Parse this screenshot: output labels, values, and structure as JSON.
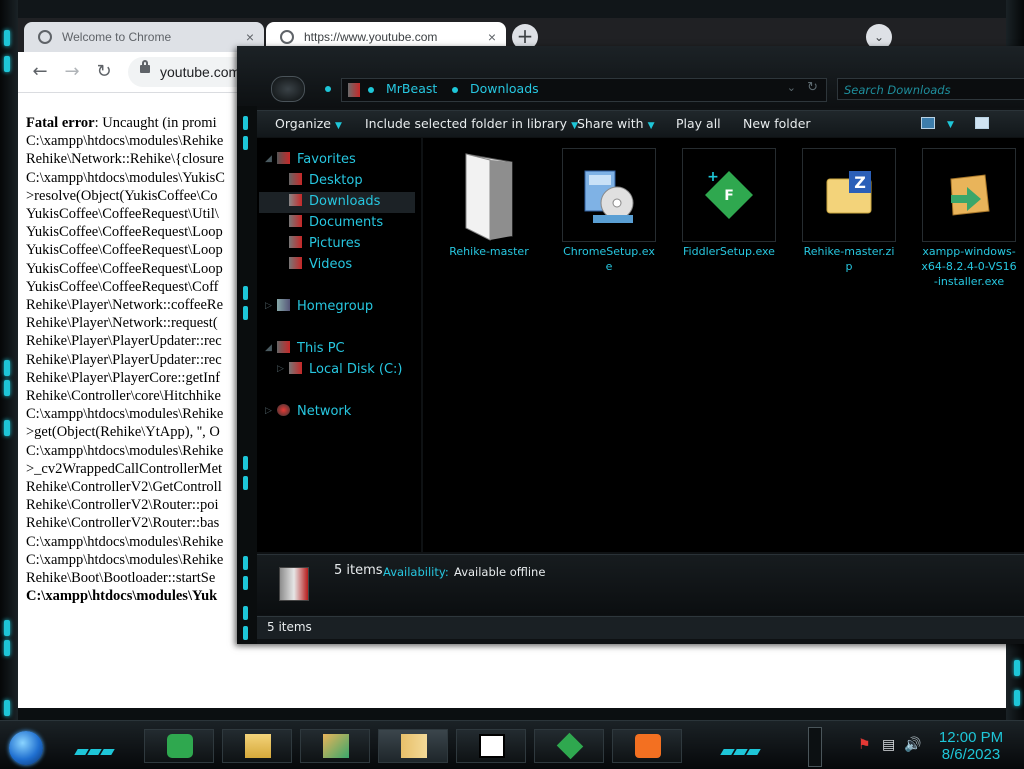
{
  "chrome": {
    "tab1_title": "Welcome to Chrome",
    "tab2_title": "https://www.youtube.com",
    "tab_close": "×",
    "new_tab": "+",
    "tab_menu": "⌄",
    "url": "youtube.com",
    "error_label": "Fatal error",
    "error_lines": [
      ": Uncaught (in promi",
      "C:\\xampp\\htdocs\\modules\\Rehike",
      "Rehike\\Network::Rehike\\{closure",
      "C:\\xampp\\htdocs\\modules\\YukisC",
      ">resolve(Object(YukisCoffee\\Co",
      "YukisCoffee\\CoffeeRequest\\Util\\",
      "YukisCoffee\\CoffeeRequest\\Loop",
      "YukisCoffee\\CoffeeRequest\\Loop",
      "YukisCoffee\\CoffeeRequest\\Loop",
      "YukisCoffee\\CoffeeRequest\\Coff",
      "Rehike\\Player\\Network::coffeeRe",
      "Rehike\\Player\\Network::request(",
      "Rehike\\Player\\PlayerUpdater::rec",
      "Rehike\\Player\\PlayerUpdater::rec",
      "Rehike\\Player\\PlayerCore::getInf",
      "Rehike\\Controller\\core\\Hitchhike",
      "C:\\xampp\\htdocs\\modules\\Rehike",
      ">get(Object(Rehike\\YtApp), '', O",
      "C:\\xampp\\htdocs\\modules\\Rehike",
      ">_cv2WrappedCallControllerMet",
      "Rehike\\ControllerV2\\GetControll",
      "Rehike\\ControllerV2\\Router::poi",
      "Rehike\\ControllerV2\\Router::bas",
      "C:\\xampp\\htdocs\\modules\\Rehike",
      "C:\\xampp\\htdocs\\modules\\Rehike",
      "Rehike\\Boot\\Bootloader::startSe",
      "C:\\xampp\\htdocs\\modules\\Yuk"
    ]
  },
  "explorer": {
    "breadcrumb": [
      "MrBeast",
      "Downloads"
    ],
    "search_placeholder": "Search Downloads",
    "commands": [
      "Organize",
      "Include selected folder in library",
      "Share with",
      "Play all",
      "New folder"
    ],
    "nav": {
      "favorites": "Favorites",
      "desktop": "Desktop",
      "downloads": "Downloads",
      "documents": "Documents",
      "pictures": "Pictures",
      "videos": "Videos",
      "homegroup": "Homegroup",
      "this_pc": "This PC",
      "local_disk": "Local Disk (C:)",
      "network": "Network"
    },
    "files": [
      {
        "name": "Rehike-master",
        "icon": "folder-icon"
      },
      {
        "name": "ChromeSetup.exe",
        "icon": "installer-icon"
      },
      {
        "name": "FiddlerSetup.exe",
        "icon": "fiddler-icon"
      },
      {
        "name": "Rehike-master.zip",
        "icon": "zip-icon"
      },
      {
        "name": "xampp-windows-x64-8.2.4-0-VS16-installer.exe",
        "icon": "xampp-installer-icon"
      }
    ],
    "details": {
      "count": "5 items",
      "availability_label": "Availability:",
      "availability_value": "Available offline"
    },
    "status": "5 items"
  },
  "taskbar": {
    "time": "12:00 PM",
    "date": "8/6/2023"
  },
  "colors": {
    "accent_cyan": "#1ec6d8",
    "explorer_text": "#27c7e0",
    "fiddler_green": "#2fa84f",
    "xampp_orange": "#f37021"
  }
}
